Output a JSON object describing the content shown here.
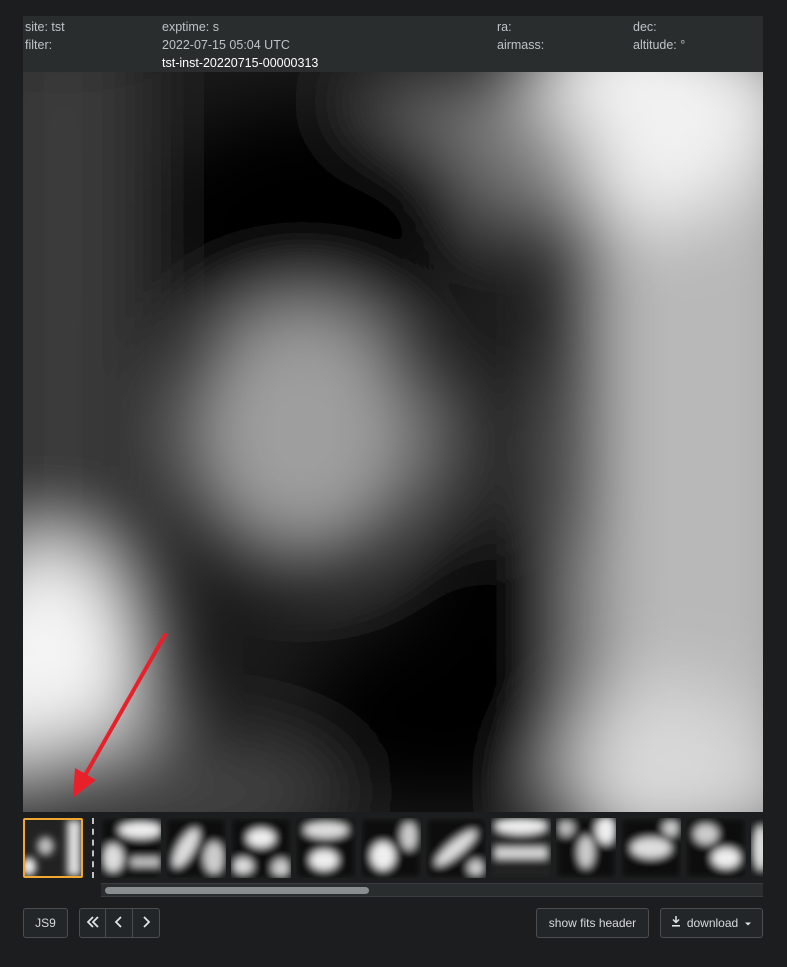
{
  "header": {
    "site_label": "site: tst",
    "filter_label": "filter:",
    "exptime_label": "exptime: s",
    "date": "2022-07-15 05:04 UTC",
    "filename": "tst-inst-20220715-00000313",
    "ra_label": "ra:",
    "airmass_label": "airmass:",
    "dec_label": "dec:",
    "altitude_label": "altitude: °"
  },
  "thumbnails": {
    "count_visible": 12,
    "selected_index": 0
  },
  "scrollbar": {
    "position_fraction": 0.0,
    "visible_fraction": 0.4
  },
  "controls": {
    "js9_label": "JS9",
    "first_icon": "double-chevron-left-icon",
    "prev_icon": "chevron-left-icon",
    "next_icon": "chevron-right-icon",
    "fits_label": "show fits header",
    "download_label": "download",
    "download_icon": "download-icon",
    "caret_icon": "caret-down-icon"
  },
  "colors": {
    "selected_border": "#f0a830",
    "annotation_arrow": "#e8202a"
  }
}
